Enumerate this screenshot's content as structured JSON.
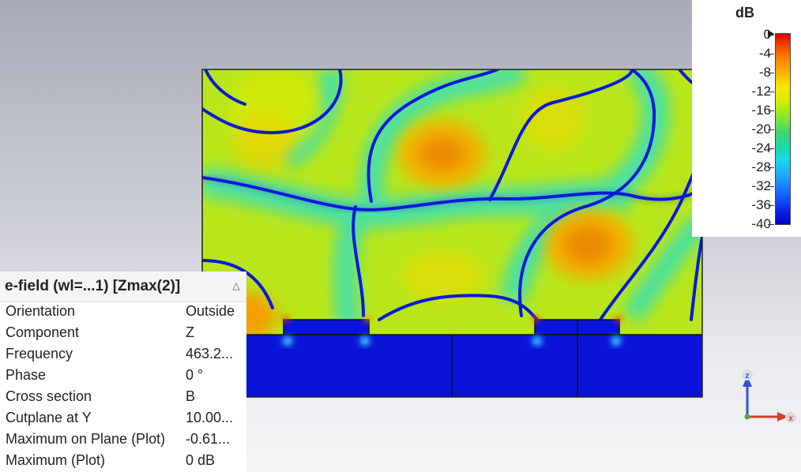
{
  "legend": {
    "title": "dB",
    "ticks": [
      "0",
      "-4",
      "-8",
      "-12",
      "-16",
      "-20",
      "-24",
      "-28",
      "-32",
      "-36",
      "-40"
    ]
  },
  "panel": {
    "title": "e-field (wl=...1) [Zmax(2)]",
    "collapse_icon": "chevron-up-icon",
    "rows": [
      {
        "name": "Orientation",
        "value": "Outside"
      },
      {
        "name": "Component",
        "value": "Z"
      },
      {
        "name": "Frequency",
        "value": "463.2..."
      },
      {
        "name": "Phase",
        "value": "0 °"
      },
      {
        "name": "Cross section",
        "value": "B"
      },
      {
        "name": "Cutplane at Y",
        "value": "10.00..."
      },
      {
        "name": "Maximum on Plane (Plot)",
        "value": "-0.61..."
      },
      {
        "name": "Maximum (Plot)",
        "value": "0 dB"
      }
    ]
  },
  "axes": {
    "z_label": "z",
    "x_label": "x",
    "z_color": "#2f55d6",
    "x_color": "#d63a2f"
  },
  "colors": {
    "substrate": "#0a14d8",
    "field_background": "#c8e800"
  }
}
